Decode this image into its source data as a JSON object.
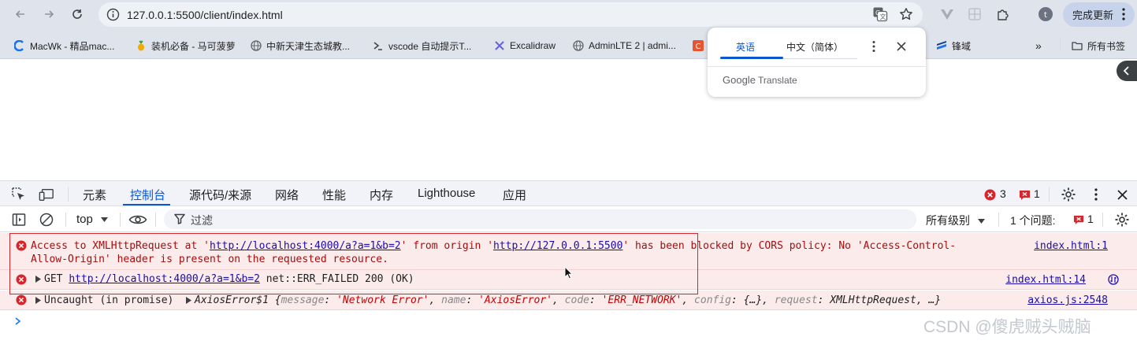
{
  "browser": {
    "url": "127.0.0.1:5500/client/index.html",
    "update_label": "完成更新",
    "profile_initial": "t"
  },
  "bookmarks": [
    {
      "label": "MacWk - 精品mac...",
      "icon": "macwk-icon",
      "color": "#1a73e8"
    },
    {
      "label": "装机必备 - 马可菠萝",
      "icon": "pineapple-icon",
      "color": "#f2a900"
    },
    {
      "label": "中新天津生态城教...",
      "icon": "globe-icon",
      "color": "#5f6368"
    },
    {
      "label": "vscode 自动提示T...",
      "icon": "vscode-icon",
      "color": "#444"
    },
    {
      "label": "Excalidraw",
      "icon": "excalidraw-icon",
      "color": "#6965db"
    },
    {
      "label": "AdminLTE 2 | admi...",
      "icon": "globe-icon",
      "color": "#5f6368"
    },
    {
      "label": "锋域",
      "icon": "fengyu-icon",
      "color": "#1a73e8"
    },
    {
      "label": "所有书签",
      "icon": "folder-icon",
      "color": "#444"
    }
  ],
  "bookmarks_overflow": "»",
  "translate_popup": {
    "tab_source": "英语",
    "tab_target": "中文（简体）",
    "brand_google": "Google",
    "brand_translate": "Translate"
  },
  "devtools": {
    "tabs": [
      "元素",
      "控制台",
      "源代码/来源",
      "网络",
      "性能",
      "内存",
      "Lighthouse",
      "应用"
    ],
    "active_tab": "控制台",
    "error_count": "3",
    "issue_count": "1",
    "context": "top",
    "filter_placeholder": "过滤",
    "levels": "所有级别",
    "issues_label": "1 个问题:",
    "issues_badge": "1"
  },
  "console": {
    "msg1": {
      "pre": "Access to XMLHttpRequest at '",
      "url1": "http://localhost:4000/a?a=1&b=2",
      "mid": "' from origin '",
      "url2": "http://127.0.0.1:5500",
      "post": "' has been blocked by CORS policy: No 'Access-Control-",
      "line2": "Allow-Origin' header is present on the requested resource.",
      "source": "index.html:1"
    },
    "msg2": {
      "method": "GET",
      "url": "http://localhost:4000/a?a=1&b=2",
      "status": "net::ERR_FAILED 200 (OK)",
      "source": "index.html:14"
    },
    "msg3": {
      "prefix": "Uncaught (in promise)",
      "cls": "AxiosError$1",
      "open": " {",
      "k1": "message",
      "v1": "'Network Error'",
      "k2": "name",
      "v2": "'AxiosError'",
      "k3": "code",
      "v3": "'ERR_NETWORK'",
      "k4": "config",
      "v4": "{…}",
      "k5": "request",
      "v5": "XMLHttpRequest",
      "tail": ", …}",
      "source": "axios.js:2548"
    }
  },
  "watermark": "CSDN @傻虎贼头贼脑",
  "colors": {
    "accent": "#0b57d0",
    "error": "#d6262c",
    "error_bg": "#fcebeb"
  }
}
